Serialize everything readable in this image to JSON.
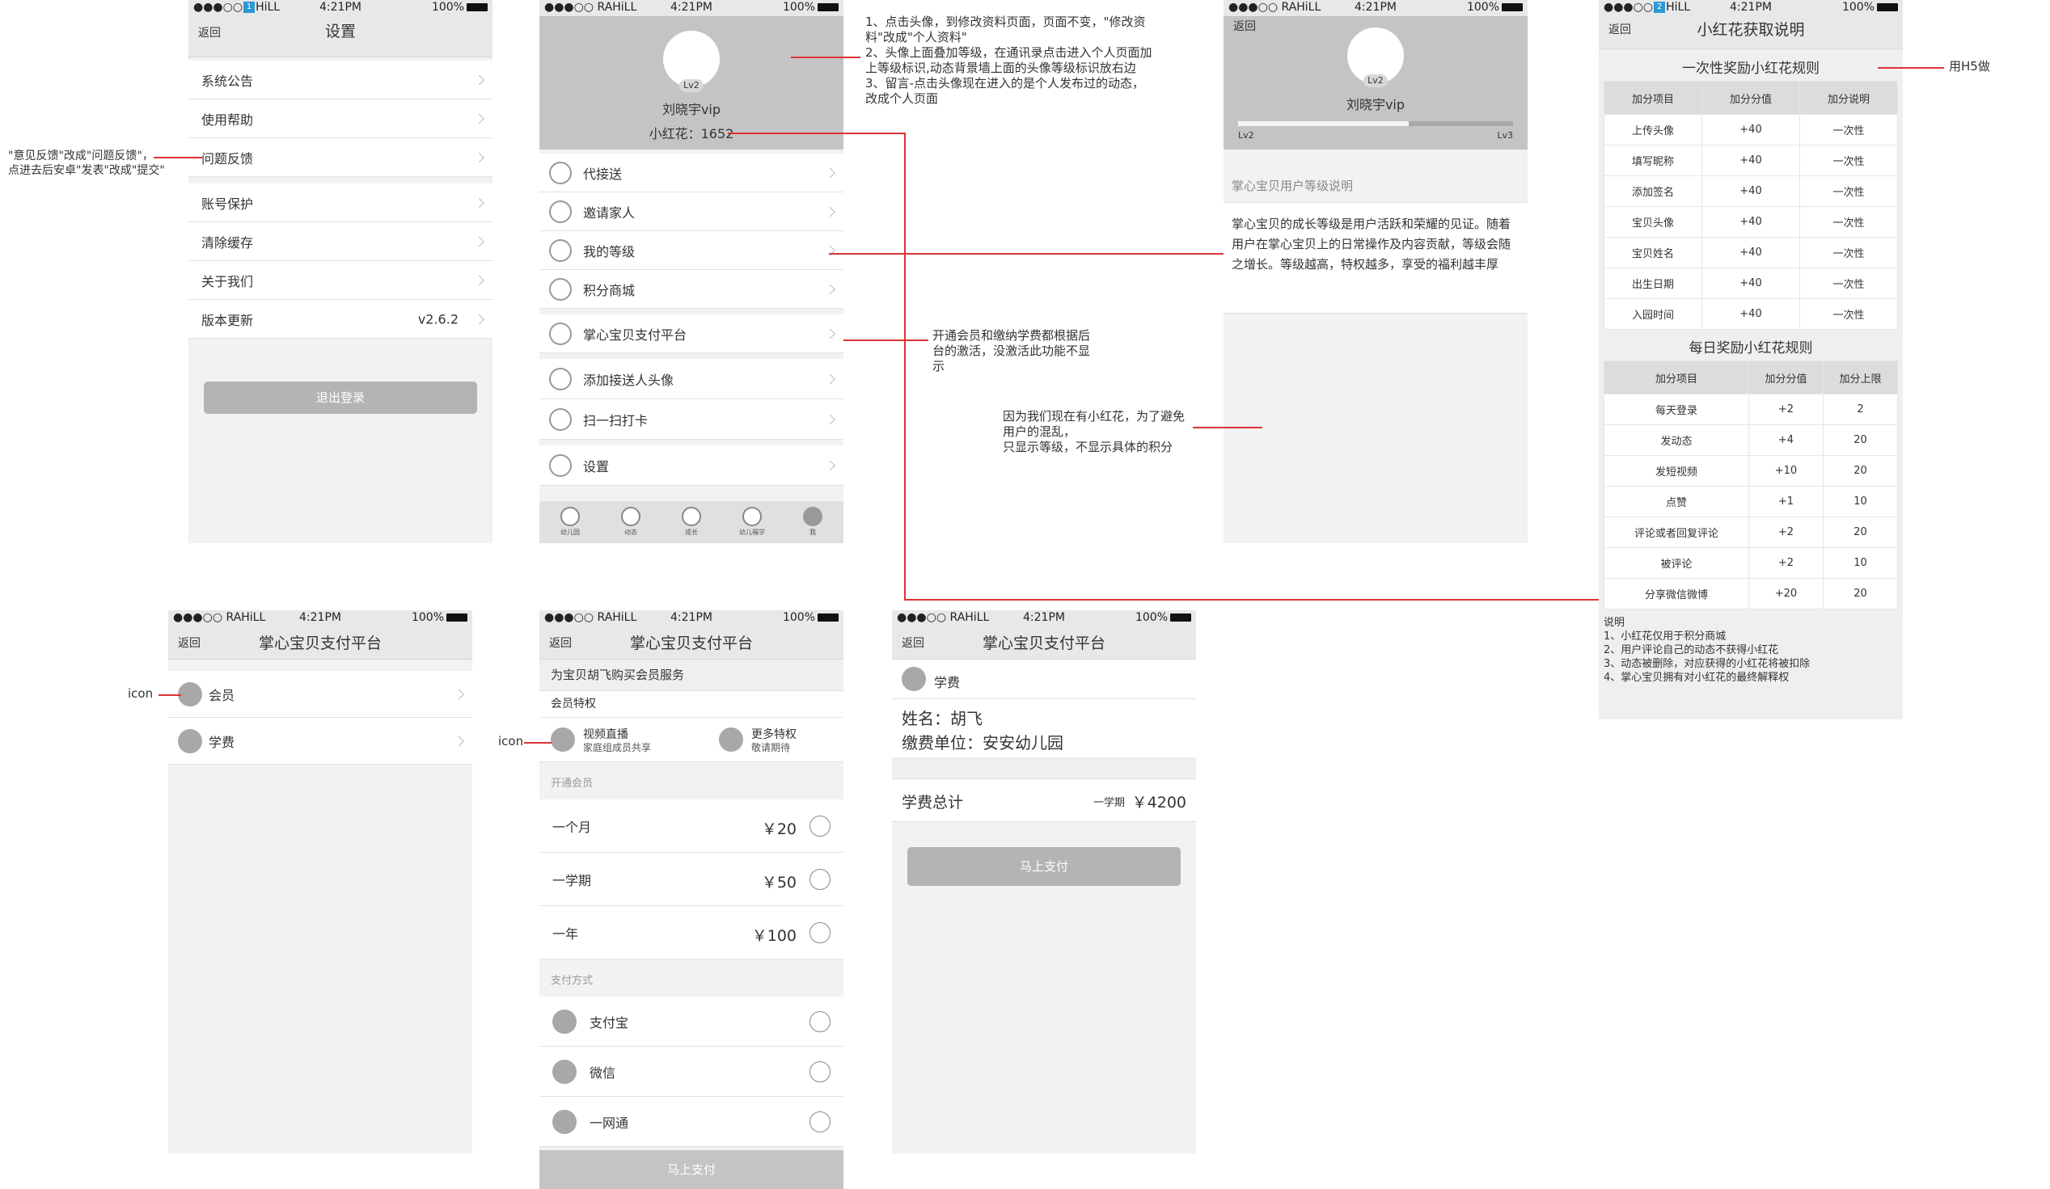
{
  "status": {
    "carrier": "●●●○○ RAHiLL",
    "time": "4:21PM",
    "battery": "100%",
    "badge1": "1",
    "badge2": "2"
  },
  "common": {
    "back": "返回",
    "chevron": "chevron-right-icon"
  },
  "s1": {
    "title": "设置",
    "items": [
      "系统公告",
      "使用帮助",
      "问题反馈",
      "账号保护",
      "清除缓存",
      "关于我们",
      "版本更新"
    ],
    "version": "v2.6.2",
    "logout": "退出登录"
  },
  "s2": {
    "level": "Lv2",
    "name": "刘晓宇vip",
    "flowers": "小红花：1652",
    "menu": [
      "代接送",
      "邀请家人",
      "我的等级",
      "积分商城",
      "掌心宝贝支付平台",
      "添加接送人头像",
      "扫一扫打卡",
      "设置"
    ],
    "tabs": [
      "幼儿园",
      "动态",
      "成长",
      "幼儿福学",
      "我"
    ]
  },
  "s3": {
    "level": "Lv2",
    "name": "刘晓宇vip",
    "from": "Lv2",
    "to": "Lv3",
    "progress": 0.62,
    "section": "掌心宝贝用户等级说明",
    "desc": "掌心宝贝的成长等级是用户活跃和荣耀的见证。随着用户在掌心宝贝上的日常操作及内容贡献，等级会随之增长。等级越高，特权越多，享受的福利越丰厚"
  },
  "s4": {
    "title": "小红花获取说明",
    "once_title": "一次性奖励小红花规则",
    "once_head": [
      "加分项目",
      "加分分值",
      "加分说明"
    ],
    "once_rows": [
      [
        "上传头像",
        "+40",
        "一次性"
      ],
      [
        "填写昵称",
        "+40",
        "一次性"
      ],
      [
        "添加签名",
        "+40",
        "一次性"
      ],
      [
        "宝贝头像",
        "+40",
        "一次性"
      ],
      [
        "宝贝姓名",
        "+40",
        "一次性"
      ],
      [
        "出生日期",
        "+40",
        "一次性"
      ],
      [
        "入园时间",
        "+40",
        "一次性"
      ]
    ],
    "daily_title": "每日奖励小红花规则",
    "daily_head": [
      "加分项目",
      "加分分值",
      "加分上限"
    ],
    "daily_rows": [
      [
        "每天登录",
        "+2",
        "2"
      ],
      [
        "发动态",
        "+4",
        "20"
      ],
      [
        "发短视频",
        "+10",
        "20"
      ],
      [
        "点赞",
        "+1",
        "10"
      ],
      [
        "评论或者回复评论",
        "+2",
        "20"
      ],
      [
        "被评论",
        "+2",
        "10"
      ],
      [
        "分享微信微博",
        "+20",
        "20"
      ]
    ],
    "notes": "说明\n1、小红花仅用于积分商城\n2、用户评论自己的动态不获得小红花\n3、动态被删除，对应获得的小红花将被扣除\n4、掌心宝贝拥有对小红花的最终解释权"
  },
  "s5": {
    "title": "掌心宝贝支付平台",
    "items": [
      "会员",
      "学费"
    ]
  },
  "s6": {
    "title": "掌心宝贝支付平台",
    "header": "为宝贝胡飞购买会员服务",
    "perks_title": "会员特权",
    "perk1_name": "视频直播",
    "perk1_sub": "家庭组成员共享",
    "perk2_name": "更多特权",
    "perk2_sub": "敬请期待",
    "open_title": "开通会员",
    "plans": [
      {
        "label": "一个月",
        "price": "￥20"
      },
      {
        "label": "一学期",
        "price": "￥50"
      },
      {
        "label": "一年",
        "price": "￥100"
      }
    ],
    "pay_title": "支付方式",
    "methods": [
      "支付宝",
      "微信",
      "一网通"
    ],
    "pay_button": "马上支付"
  },
  "s7": {
    "item": "学费",
    "name": "姓名：胡飞",
    "unit": "缴费单位：安安幼儿园",
    "total_label": "学费总计",
    "period": "一学期",
    "amount": "￥4200",
    "pay_button": "马上支付"
  },
  "notes": {
    "n1": "\"意见反馈\"改成\"问题反馈\"，\n点进去后安卓\"发表\"改成\"提交\"",
    "n2": "1、点击头像，到修改资料页面，页面不变，\"修改资\n料\"改成\"个人资料\"\n2、头像上面叠加等级，在通讯录点击进入个人页面加\n上等级标识,动态背景墙上面的头像等级标识放右边\n3、留言-点击头像现在进入的是个人发布过的动态，\n改成个人页面",
    "n3": "开通会员和缴纳学费都根据后\n台的激活，没激活此功能不显\n示",
    "n4": "因为我们现在有小红花，为了避免\n用户的混乱，\n只显示等级，不显示具体的积分",
    "n5": "用H5做",
    "n6": "icon",
    "n7": "icon"
  }
}
